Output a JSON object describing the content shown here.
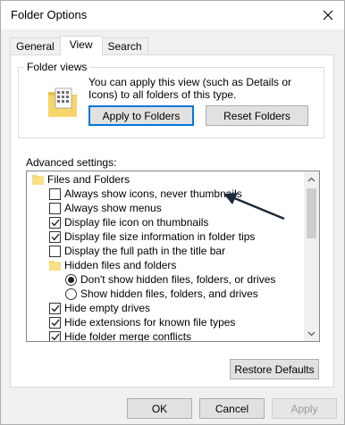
{
  "window": {
    "title": "Folder Options"
  },
  "tabs": [
    {
      "label": "General"
    },
    {
      "label": "View"
    },
    {
      "label": "Search"
    }
  ],
  "folder_views": {
    "label": "Folder views",
    "description": "You can apply this view (such as Details or Icons) to all folders of this type.",
    "apply_button": "Apply to Folders",
    "reset_button": "Reset Folders"
  },
  "advanced": {
    "label": "Advanced settings:",
    "items": [
      {
        "kind": "folder",
        "label": "Files and Folders",
        "indent": 0
      },
      {
        "kind": "checkbox",
        "label": "Always show icons, never thumbnails",
        "checked": false,
        "indent": 1
      },
      {
        "kind": "checkbox",
        "label": "Always show menus",
        "checked": false,
        "indent": 1
      },
      {
        "kind": "checkbox",
        "label": "Display file icon on thumbnails",
        "checked": true,
        "indent": 1
      },
      {
        "kind": "checkbox",
        "label": "Display file size information in folder tips",
        "checked": true,
        "indent": 1
      },
      {
        "kind": "checkbox",
        "label": "Display the full path in the title bar",
        "checked": false,
        "indent": 1
      },
      {
        "kind": "folder",
        "label": "Hidden files and folders",
        "indent": 1
      },
      {
        "kind": "radio",
        "label": "Don't show hidden files, folders, or drives",
        "checked": true,
        "indent": 2
      },
      {
        "kind": "radio",
        "label": "Show hidden files, folders, and drives",
        "checked": false,
        "indent": 2
      },
      {
        "kind": "checkbox",
        "label": "Hide empty drives",
        "checked": true,
        "indent": 1
      },
      {
        "kind": "checkbox",
        "label": "Hide extensions for known file types",
        "checked": true,
        "indent": 1
      },
      {
        "kind": "checkbox",
        "label": "Hide folder merge conflicts",
        "checked": true,
        "indent": 1
      }
    ]
  },
  "restore_button": "Restore Defaults",
  "footer": {
    "ok": "OK",
    "cancel": "Cancel",
    "apply": "Apply"
  },
  "colors": {
    "folder": "#f6d56a",
    "accent": "#0078d7",
    "annotation_arrow": "#1b2a3a"
  },
  "icons": {
    "close": "close-icon",
    "folder": "folder-icon",
    "arrow": "arrow-annotation"
  }
}
